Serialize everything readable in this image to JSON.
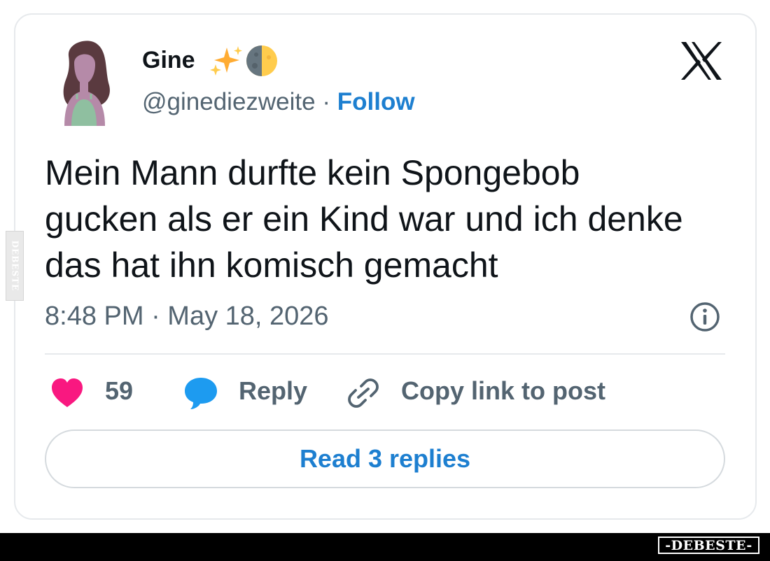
{
  "author": {
    "name": "Gine",
    "handle": "@ginediezweite",
    "separator": " · ",
    "follow_label": "Follow",
    "avatar_icon": "avatar-woman-illustration",
    "name_emoji_icons": [
      "sparkles-icon",
      "half-moon-icon"
    ]
  },
  "platform_logo": "x-logo-icon",
  "tweet": {
    "lines": [
      "Mein Mann durfte kein Spongebob",
      "gucken als er ein Kind war und ich denke",
      "das hat ihn komisch gemacht"
    ],
    "timestamp": "8:48 PM · May 18, 2026"
  },
  "actions": {
    "like_count": "59",
    "reply_label": "Reply",
    "copy_link_label": "Copy link to post",
    "read_replies_label": "Read 3 replies"
  },
  "icons": {
    "info": "info-icon",
    "like": "heart-icon",
    "reply": "speech-bubble-icon",
    "copy": "link-icon"
  },
  "watermarks": {
    "side": "DEBESTE",
    "footer": "-DEBESTE-"
  },
  "colors": {
    "text": "#0f1419",
    "secondary": "#536471",
    "link_blue": "#1d7fd0",
    "heart": "#f91880",
    "bubble": "#1d9bf0",
    "border": "#e6e9ec"
  }
}
